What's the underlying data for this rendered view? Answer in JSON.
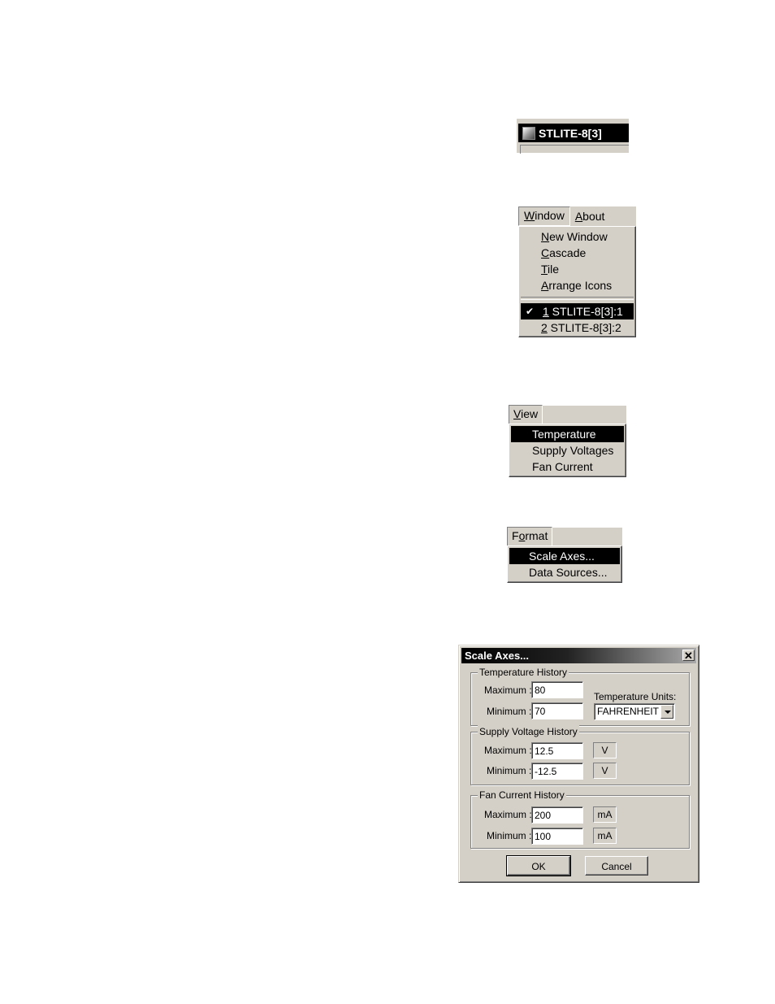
{
  "title_fragment": {
    "title": "STLITE-8[3]"
  },
  "window_menu": {
    "bar": [
      {
        "label_pre": "",
        "mnemonic": "W",
        "label_post": "indow"
      },
      {
        "label_pre": "",
        "mnemonic": "A",
        "label_post": "bout"
      }
    ],
    "items": [
      {
        "label_pre": "",
        "mnemonic": "N",
        "label_post": "ew Window"
      },
      {
        "label_pre": "",
        "mnemonic": "C",
        "label_post": "ascade"
      },
      {
        "label_pre": "",
        "mnemonic": "T",
        "label_post": "ile"
      },
      {
        "label_pre": "",
        "mnemonic": "A",
        "label_post": "rrange Icons"
      }
    ],
    "windows": [
      {
        "check": "✔",
        "mnemonic": "1",
        "label_post": " STLITE-8[3]:1"
      },
      {
        "check": "",
        "mnemonic": "2",
        "label_post": " STLITE-8[3]:2"
      }
    ]
  },
  "view_menu": {
    "bar": {
      "mnemonic": "V",
      "label_post": "iew"
    },
    "items": [
      "Temperature",
      "Supply Voltages",
      "Fan Current"
    ]
  },
  "format_menu": {
    "bar": {
      "label_pre": "F",
      "mnemonic": "o",
      "label_post": "rmat"
    },
    "items": [
      "Scale Axes...",
      "Data Sources..."
    ]
  },
  "dialog": {
    "title": "Scale Axes...",
    "close": "✕",
    "temperature": {
      "legend": "Temperature History",
      "max_label": "Maximum :",
      "max_value": "80",
      "min_label": "Minimum :",
      "min_value": "70",
      "units_label": "Temperature Units:",
      "units_value": "FAHRENHEIT"
    },
    "voltage": {
      "legend": "Supply Voltage History",
      "max_label": "Maximum :",
      "max_value": "12.5",
      "max_unit": "V",
      "min_label": "Minimum :",
      "min_value": "-12.5",
      "min_unit": "V"
    },
    "fan": {
      "legend": "Fan Current History",
      "max_label": "Maximum :",
      "max_value": "200",
      "max_unit": "mA",
      "min_label": "Minimum :",
      "min_value": "100",
      "min_unit": "mA"
    },
    "ok": "OK",
    "cancel": "Cancel"
  }
}
